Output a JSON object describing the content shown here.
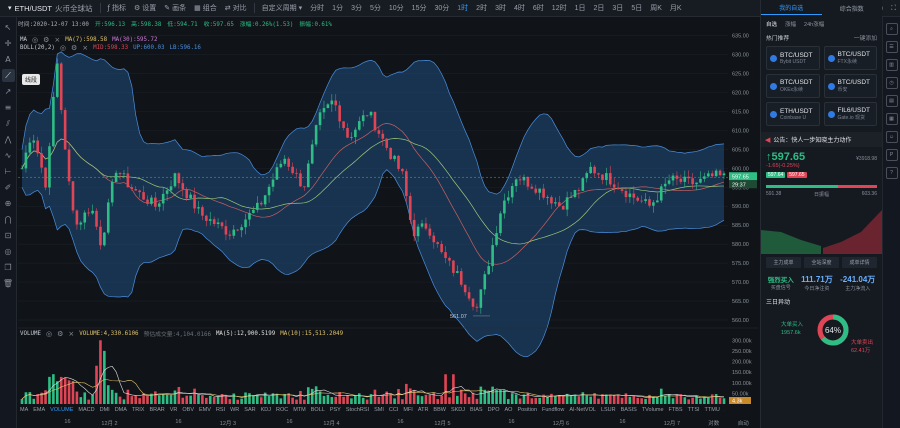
{
  "toolbar": {
    "symbol": "ETH/USDT",
    "exchange": "火币全球站",
    "indicators_label": "指标",
    "settings_label": "设置",
    "draw_label": "画条",
    "combo_label": "组合",
    "compare_label": "对比",
    "custom_period_label": "自定义周期",
    "intervals": [
      "分时",
      "1分",
      "3分",
      "5分",
      "10分",
      "15分",
      "30分",
      "1时",
      "2时",
      "3时",
      "4时",
      "6时",
      "12时",
      "1日",
      "2日",
      "3日",
      "5日",
      "周K",
      "月K"
    ],
    "active_interval": "1时",
    "right_label": "2秒"
  },
  "infoline": {
    "time": "时间:2020-12-07 13:00",
    "open": "开:596.13",
    "high": "高:598.38",
    "low": "低:594.71",
    "close": "收:597.65",
    "change": "涨幅:0.26%(1.53)",
    "amplitude": "振幅:0.61%"
  },
  "legend_ma": {
    "label": "MA",
    "ma7": "MA(7):598.58",
    "ma30": "MA(30):595.72"
  },
  "legend_boll": {
    "label": "BOLL(20,2)",
    "mid": "MID:598.33",
    "up": "UP:600.03",
    "lb": "LB:596.16"
  },
  "legend_volume": {
    "label": "VOLUME",
    "value": "VOLUME:4,330.6106",
    "extra": "预估成交量:4,104.0166",
    "ma5": "MA(5):12,900.5199",
    "ma10": "MA(10):15,513.2049"
  },
  "left_tools": {
    "tooltip": "线段"
  },
  "price_labels": {
    "current": "597.65",
    "countdown": "29:37",
    "low_marker": "561.07",
    "volume_current": "4.3k"
  },
  "ind_tabs": [
    "MA",
    "EMA",
    "VOLUME",
    "MACD",
    "DMI",
    "DMA",
    "TRIX",
    "BRAR",
    "VR",
    "OBV",
    "EMV",
    "RSI",
    "WR",
    "SAR",
    "KDJ",
    "ROC",
    "MTM",
    "BOLL",
    "PSY",
    "StochRSI",
    "SMI",
    "CCI",
    "MFI",
    "ATR",
    "BBW",
    "SKDJ",
    "BIAS",
    "DPO",
    "AO",
    "Position",
    "Fundflow",
    "AI-NetVOL",
    "LSUR",
    "BASIS",
    "TVolume",
    "FTBS",
    "TTSI",
    "TTMU",
    "AI-BSI"
  ],
  "active_ind_tab": "VOLUME",
  "date_axis": [
    {
      "label": "16",
      "pos": 0.06
    },
    {
      "label": "12月 2",
      "pos": 0.11
    },
    {
      "label": "16",
      "pos": 0.21
    },
    {
      "label": "12月 3",
      "pos": 0.27
    },
    {
      "label": "16",
      "pos": 0.36
    },
    {
      "label": "12月 4",
      "pos": 0.41
    },
    {
      "label": "16",
      "pos": 0.51
    },
    {
      "label": "12月 5",
      "pos": 0.56
    },
    {
      "label": "16",
      "pos": 0.66
    },
    {
      "label": "12月 6",
      "pos": 0.72
    },
    {
      "label": "16",
      "pos": 0.81
    },
    {
      "label": "12月 7",
      "pos": 0.87
    },
    {
      "label": "对数",
      "pos": 0.93
    },
    {
      "label": "自动",
      "pos": 0.97
    }
  ],
  "chart_data": {
    "type": "candlestick",
    "price_axis": [
      "635.00",
      "630.00",
      "625.00",
      "620.00",
      "615.00",
      "610.00",
      "605.00",
      "600.00",
      "595.00",
      "590.00",
      "585.00",
      "580.00",
      "575.00",
      "570.00",
      "565.00",
      "560.00"
    ],
    "ylim": [
      560,
      637
    ],
    "volume_axis": [
      "300.00k",
      "250.00k",
      "200.00k",
      "150.00k",
      "100.00k",
      "50.00k"
    ],
    "volume_max": 320000
  },
  "right_panel": {
    "tabs": [
      "我的自选",
      "综合指数"
    ],
    "active_tab": "我的自选",
    "sub_tabs": [
      "自选",
      "涨幅",
      "24h涨幅"
    ],
    "hot_title": "热门推荐",
    "hot_link": "一键添加",
    "hot_items": [
      {
        "name": "BTC/USDT",
        "sub": "Bybit USDT"
      },
      {
        "name": "BTC/USDT",
        "sub": "FTX永续"
      },
      {
        "name": "BTC/USDT",
        "sub": "OKEx永续"
      },
      {
        "name": "BTC/USDT",
        "sub": "币安"
      },
      {
        "name": "ETH/USDT",
        "sub": "Coinbase U"
      },
      {
        "name": "FIL6/USDT",
        "sub": "Gate.io 现货"
      }
    ],
    "notice": "公告：快人一步知晓主力动作",
    "price": "597.65",
    "price_cny": "¥3918.98",
    "change": "-1.65(-0.25%)",
    "tag_buy": "597.64",
    "tag_sell": "597.65",
    "bar_left": "591.38",
    "bar_right": "603.36",
    "bar_mid": "日振幅",
    "btns": [
      "主力成单",
      "全站深度",
      "成单详情"
    ],
    "stat1_label": "强烈买入",
    "stat1_sub": "买盘信号",
    "stat2_value": "111.71万",
    "stat2_label": "今日净注资",
    "stat3_value": "-241.04万",
    "stat3_label": "主力净流入",
    "flow_title": "三日异动",
    "flow_pct": "64%",
    "flow_buy": "大单买入",
    "flow_buy_v": "1957.6k",
    "flow_sell": "大单卖出",
    "flow_sell_v": "62.41万"
  },
  "colors": {
    "up": "#2ebd85",
    "down": "#e04555",
    "accent": "#2f9bff",
    "band": "#1f4c7d"
  },
  "icons": [
    "search-icon",
    "gear-icon",
    "camera-icon",
    "fullscreen-icon",
    "cursor-icon",
    "crosshair-icon",
    "trendline-icon",
    "trash-icon"
  ]
}
